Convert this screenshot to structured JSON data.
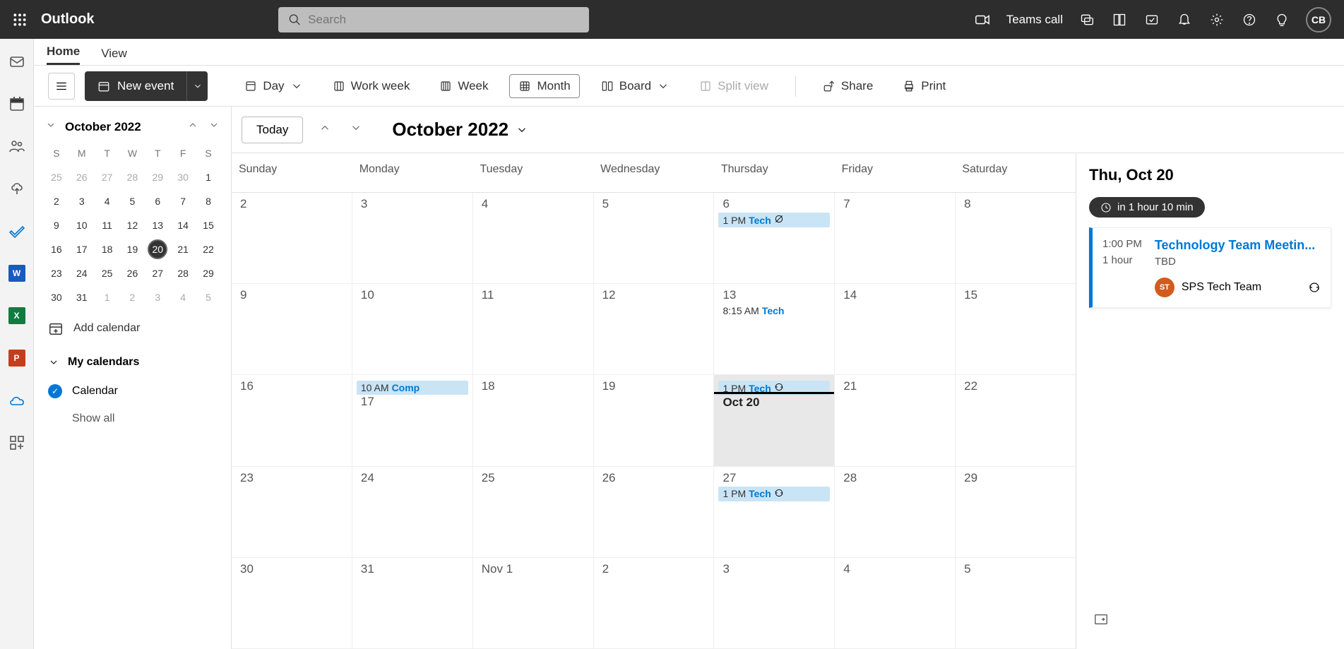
{
  "app_title": "Outlook",
  "search_placeholder": "Search",
  "teams_call": "Teams call",
  "user_initials": "CB",
  "tabs": {
    "home": "Home",
    "view": "View"
  },
  "toolbar": {
    "new_event": "New event",
    "day": "Day",
    "work_week": "Work week",
    "week": "Week",
    "month": "Month",
    "board": "Board",
    "split_view": "Split view",
    "share": "Share",
    "print": "Print"
  },
  "sidebar": {
    "month_label": "October 2022",
    "dow": [
      "S",
      "M",
      "T",
      "W",
      "T",
      "F",
      "S"
    ],
    "mini_cal": [
      [
        {
          "d": "25",
          "o": true
        },
        {
          "d": "26",
          "o": true
        },
        {
          "d": "27",
          "o": true
        },
        {
          "d": "28",
          "o": true
        },
        {
          "d": "29",
          "o": true
        },
        {
          "d": "30",
          "o": true
        },
        {
          "d": "1"
        }
      ],
      [
        {
          "d": "2"
        },
        {
          "d": "3"
        },
        {
          "d": "4"
        },
        {
          "d": "5"
        },
        {
          "d": "6"
        },
        {
          "d": "7"
        },
        {
          "d": "8"
        }
      ],
      [
        {
          "d": "9"
        },
        {
          "d": "10"
        },
        {
          "d": "11"
        },
        {
          "d": "12"
        },
        {
          "d": "13"
        },
        {
          "d": "14"
        },
        {
          "d": "15"
        }
      ],
      [
        {
          "d": "16"
        },
        {
          "d": "17"
        },
        {
          "d": "18"
        },
        {
          "d": "19"
        },
        {
          "d": "20",
          "today": true
        },
        {
          "d": "21"
        },
        {
          "d": "22"
        }
      ],
      [
        {
          "d": "23"
        },
        {
          "d": "24"
        },
        {
          "d": "25"
        },
        {
          "d": "26"
        },
        {
          "d": "27"
        },
        {
          "d": "28"
        },
        {
          "d": "29"
        }
      ],
      [
        {
          "d": "30"
        },
        {
          "d": "31"
        },
        {
          "d": "1",
          "o": true
        },
        {
          "d": "2",
          "o": true
        },
        {
          "d": "3",
          "o": true
        },
        {
          "d": "4",
          "o": true
        },
        {
          "d": "5",
          "o": true
        }
      ]
    ],
    "add_calendar": "Add calendar",
    "my_calendars": "My calendars",
    "calendar_name": "Calendar",
    "show_all": "Show all"
  },
  "cal_header": {
    "today": "Today",
    "title": "October 2022"
  },
  "day_headers": [
    "Sunday",
    "Monday",
    "Tuesday",
    "Wednesday",
    "Thursday",
    "Friday",
    "Saturday"
  ],
  "weeks": [
    [
      {
        "label": "2"
      },
      {
        "label": "3"
      },
      {
        "label": "4"
      },
      {
        "label": "5"
      },
      {
        "label": "6",
        "events": [
          {
            "time": "1 PM",
            "title": "Tech",
            "icon": "noskip"
          }
        ]
      },
      {
        "label": "7"
      },
      {
        "label": "8"
      }
    ],
    [
      {
        "label": "9"
      },
      {
        "label": "10"
      },
      {
        "label": "11"
      },
      {
        "label": "12"
      },
      {
        "label": "13",
        "events": [
          {
            "time": "8:15 AM",
            "title": "Tech",
            "light": true
          }
        ]
      },
      {
        "label": "14"
      },
      {
        "label": "15"
      }
    ],
    [
      {
        "label": "16"
      },
      {
        "label": "17",
        "pre_events": [
          {
            "time": "10 AM",
            "title": "Comp"
          }
        ]
      },
      {
        "label": "18"
      },
      {
        "label": "19"
      },
      {
        "label": "Oct 20",
        "today": true,
        "pre_events": [
          {
            "time": "1 PM",
            "title": "Tech",
            "icon": "recur"
          }
        ],
        "now_line": true
      },
      {
        "label": "21"
      },
      {
        "label": "22"
      }
    ],
    [
      {
        "label": "23"
      },
      {
        "label": "24"
      },
      {
        "label": "25"
      },
      {
        "label": "26"
      },
      {
        "label": "27",
        "events": [
          {
            "time": "1 PM",
            "title": "Tech",
            "icon": "recur"
          }
        ]
      },
      {
        "label": "28"
      },
      {
        "label": "29"
      }
    ],
    [
      {
        "label": "30"
      },
      {
        "label": "31"
      },
      {
        "label": "Nov 1"
      },
      {
        "label": "2"
      },
      {
        "label": "3"
      },
      {
        "label": "4"
      },
      {
        "label": "5"
      }
    ]
  ],
  "agenda": {
    "title": "Thu, Oct 20",
    "countdown": "in 1 hour 10 min",
    "event_time": "1:00 PM",
    "event_duration": "1 hour",
    "event_title": "Technology Team Meetin...",
    "event_location": "TBD",
    "organizer_initials": "ST",
    "organizer_name": "SPS Tech Team"
  }
}
